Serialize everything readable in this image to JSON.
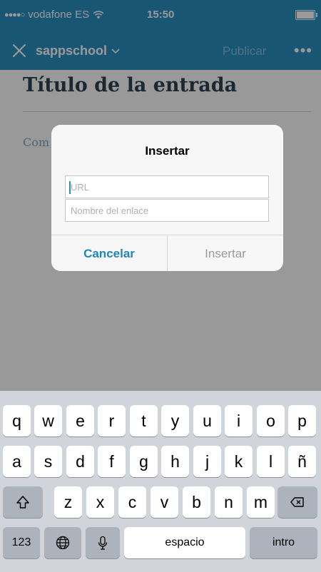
{
  "status": {
    "signal_dots": "●●●●○",
    "carrier": "vodafone ES",
    "time": "15:50"
  },
  "nav": {
    "site": "sappschool",
    "publish": "Publicar",
    "more": "•••"
  },
  "editor": {
    "title_placeholder": "Título de la entrada",
    "content_placeholder": "Com"
  },
  "dialog": {
    "title": "Insertar",
    "url_placeholder": "URL",
    "name_placeholder": "Nombre del enlace",
    "cancel": "Cancelar",
    "insert": "Insertar"
  },
  "keyboard": {
    "row1": [
      "q",
      "w",
      "e",
      "r",
      "t",
      "y",
      "u",
      "i",
      "o",
      "p"
    ],
    "row2": [
      "a",
      "s",
      "d",
      "f",
      "g",
      "h",
      "j",
      "k",
      "l",
      "ñ"
    ],
    "row3": [
      "z",
      "x",
      "c",
      "v",
      "b",
      "n",
      "m"
    ],
    "numbers": "123",
    "space": "espacio",
    "return": "intro"
  },
  "colors": {
    "accent": "#2b8fc0",
    "dialog_button": "#1f87b8"
  }
}
